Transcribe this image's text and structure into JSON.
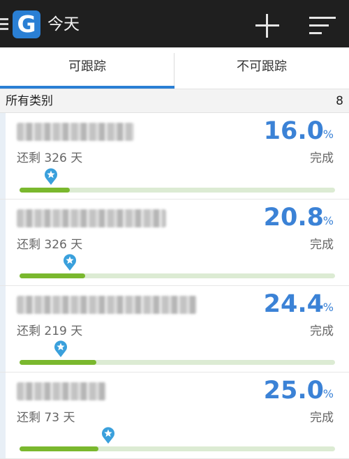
{
  "header": {
    "title": "今天",
    "logo_letter": "G"
  },
  "tabs": [
    {
      "label": "可跟踪",
      "selected": true
    },
    {
      "label": "不可跟踪",
      "selected": false
    }
  ],
  "group": {
    "title": "所有类别",
    "count": "8"
  },
  "goals": [
    {
      "percent": "16.0",
      "percent_sign": "%",
      "remaining": "还剩 326 天",
      "status": "完成",
      "progress": 0.16,
      "marker": 0.1
    },
    {
      "percent": "20.8",
      "percent_sign": "%",
      "remaining": "还剩 326 天",
      "status": "完成",
      "progress": 0.208,
      "marker": 0.16
    },
    {
      "percent": "24.4",
      "percent_sign": "%",
      "remaining": "还剩 219 天",
      "status": "完成",
      "progress": 0.244,
      "marker": 0.13
    },
    {
      "percent": "25.0",
      "percent_sign": "%",
      "remaining": "还剩 73 天",
      "status": "完成",
      "progress": 0.25,
      "marker": 0.28
    }
  ],
  "colors": {
    "accent": "#3b82d6",
    "progress_fill": "#7ab82e",
    "progress_track": "#dcebd3",
    "appbar": "#1f1f1f"
  }
}
